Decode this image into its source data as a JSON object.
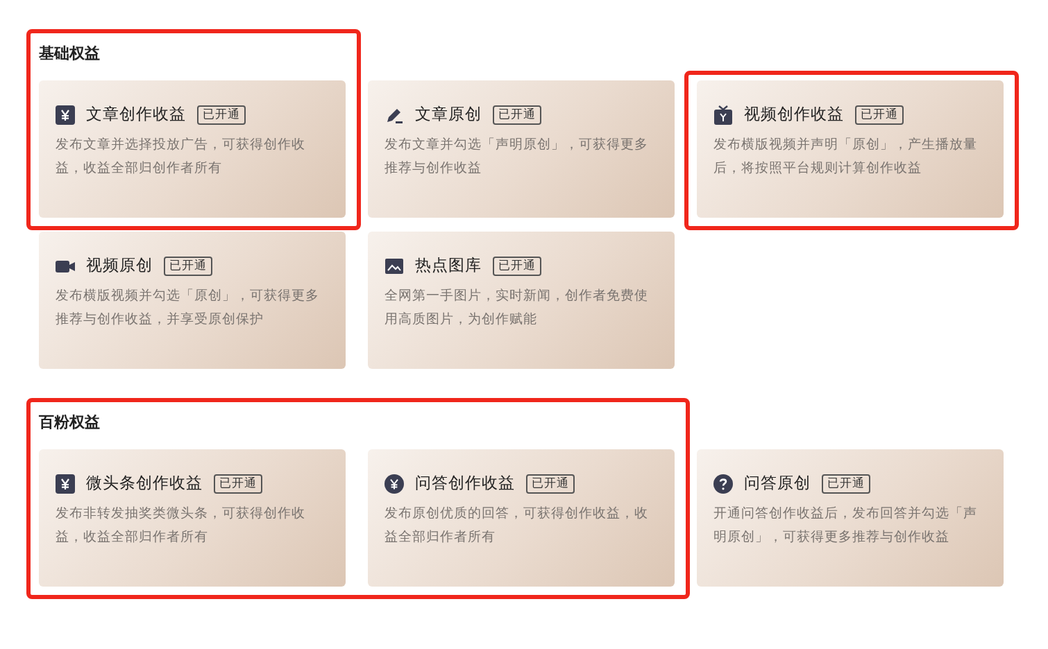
{
  "sections": [
    {
      "title": "基础权益",
      "title_highlighted": true,
      "rows": [
        [
          {
            "kind": "money",
            "title": "文章创作收益",
            "badge": "已开通",
            "description": "发布文章并选择投放广告，可获得创作收益，收益全部归创作者所有",
            "highlighted": true
          },
          {
            "kind": "pen",
            "title": "文章原创",
            "badge": "已开通",
            "description": "发布文章并勾选「声明原创」，可获得更多推荐与创作收益"
          },
          {
            "kind": "tv",
            "title": "视频创作收益",
            "badge": "已开通",
            "description": "发布横版视频并声明「原创」，产生播放量后，将按照平台规则计算创作收益",
            "highlighted": true
          }
        ],
        [
          {
            "kind": "camera",
            "title": "视频原创",
            "badge": "已开通",
            "description": "发布横版视频并勾选「原创」，可获得更多推荐与创作收益，并享受原创保护"
          },
          {
            "kind": "image",
            "title": "热点图库",
            "badge": "已开通",
            "description": "全网第一手图片，实时新闻，创作者免费使用高质图片，为创作赋能"
          }
        ]
      ]
    },
    {
      "title": "百粉权益",
      "title_highlighted": true,
      "rows": [
        [
          {
            "kind": "money",
            "title": "微头条创作收益",
            "badge": "已开通",
            "description": "发布非转发抽奖类微头条，可获得创作收益，收益全部归作者所有",
            "highlighted": true
          },
          {
            "kind": "coin",
            "title": "问答创作收益",
            "badge": "已开通",
            "description": "发布原创优质的回答，可获得创作收益，收益全部归作者所有",
            "highlighted": true
          },
          {
            "kind": "question",
            "title": "问答原创",
            "badge": "已开通",
            "description": "开通问答创作收益后，发布回答并勾选「声明原创」，可获得更多推荐与创作收益"
          }
        ]
      ]
    }
  ]
}
